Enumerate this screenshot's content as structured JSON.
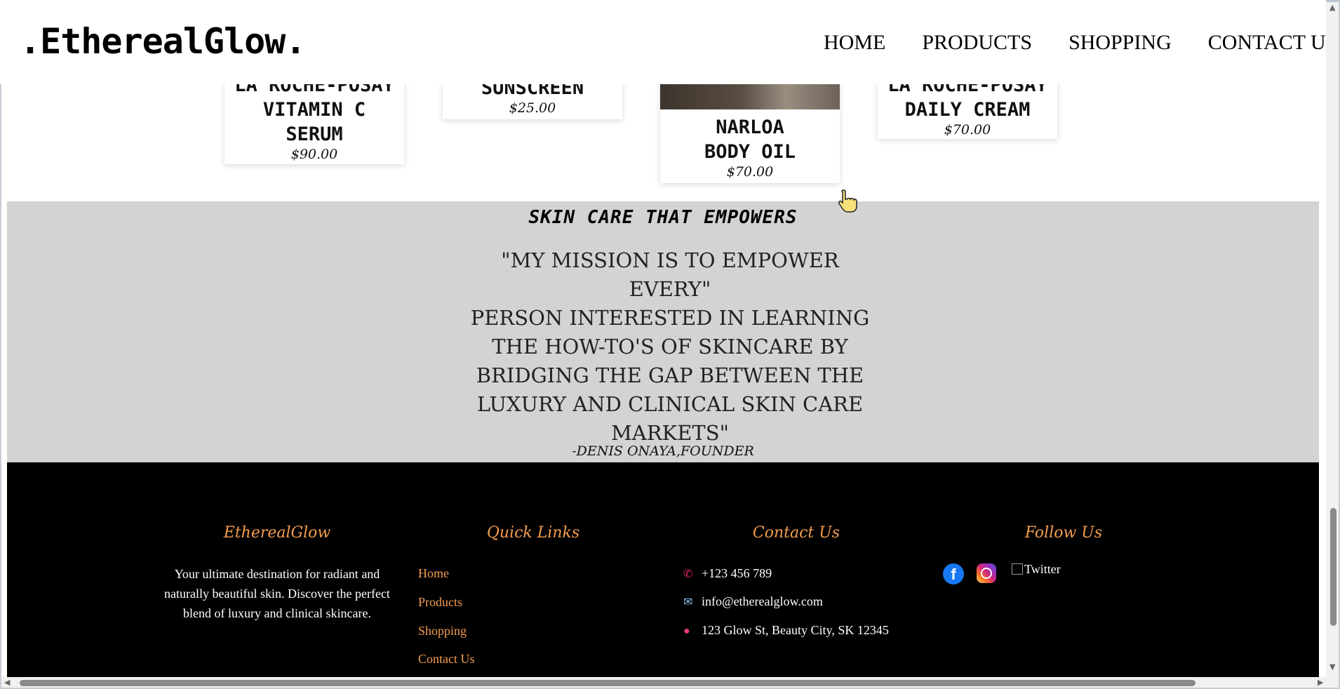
{
  "header": {
    "logo": ".EtherealGlow.",
    "nav": [
      "HOME",
      "PRODUCTS",
      "SHOPPING",
      "CONTACT US"
    ]
  },
  "products": [
    {
      "name_line1": "LA ROCHE-POSAY",
      "name_line2": "VITAMIN C",
      "name_line3": "SERUM",
      "price": "$90.00"
    },
    {
      "name_line1": "SUNSCREEN",
      "price": "$25.00"
    },
    {
      "name_line1": "NARLOA",
      "name_line2": "BODY OIL",
      "price": "$70.00"
    },
    {
      "name_line1": "LA ROCHE-POSAY",
      "name_line2": "DAILY CREAM",
      "price": "$70.00"
    }
  ],
  "quote": {
    "title": "SKIN CARE THAT EMPOWERS",
    "lines": [
      "\"MY MISSION IS TO EMPOWER EVERY\"",
      "PERSON INTERESTED IN LEARNING",
      "THE HOW-TO'S OF SKINCARE BY",
      "BRIDGING THE GAP BETWEEN THE",
      "LUXURY AND CLINICAL SKIN CARE",
      "MARKETS\""
    ],
    "author": "-DENIS ONAYA,FOUNDER"
  },
  "footer": {
    "brand_heading": "EtherealGlow",
    "about_text": "Your ultimate destination for radiant and naturally beautiful skin. Discover the perfect blend of luxury and clinical skincare.",
    "links_heading": "Quick Links",
    "links": [
      "Home",
      "Products",
      "Shopping",
      "Contact Us"
    ],
    "contact_heading": "Contact Us",
    "phone": "+123 456 789",
    "email": "info@etherealglow.com",
    "address": "123 Glow St, Beauty City, SK 12345",
    "follow_heading": "Follow Us",
    "twitter_alt": "Twitter",
    "icons": [
      "phone-icon",
      "email-icon",
      "location-pin-icon",
      "facebook-icon",
      "instagram-icon"
    ]
  },
  "colors": {
    "accent": "#f39c4f",
    "quote_bg": "#d3d3d3",
    "footer_bg": "#000000"
  }
}
